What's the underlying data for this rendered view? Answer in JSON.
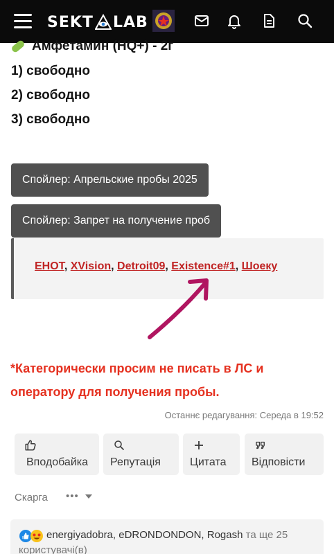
{
  "navbar": {
    "logo_left": "SEKT",
    "logo_right": "LAB"
  },
  "content": {
    "title": "Амфетамин (HQ+) - 2г",
    "slots": [
      "1) свободно",
      "2) свободно",
      "3) свободно"
    ],
    "spoiler1": "Спойлер: Апрельские пробы 2025",
    "spoiler2": "Спойлер: Запрет на получение проб",
    "names": [
      "ЕНОТ",
      "XVision",
      "Detroit09",
      "Existence#1",
      "Шоеку"
    ],
    "warning_line1": "*Категорически просим не писать в ЛС и",
    "warning_line2": "оператору для получения пробы."
  },
  "meta": {
    "edited": "Останнє редагування: Середа в 19:52"
  },
  "actions": {
    "like": "Вподобайка",
    "reputation": "Репутація",
    "quote": "Цитата",
    "reply": "Відповісти",
    "report": "Скарга",
    "more": "•••"
  },
  "reactions": {
    "users": "energiyadobra, eDRONDONDON, Rogash",
    "rest": " та ще 25",
    "line2": "користувачі(в)"
  },
  "colors": {
    "navbar": "#0b0b0b",
    "link_red": "#c02424",
    "warning_red": "#e53120",
    "spoiler_bg": "#505050",
    "arrow": "#b01560"
  }
}
